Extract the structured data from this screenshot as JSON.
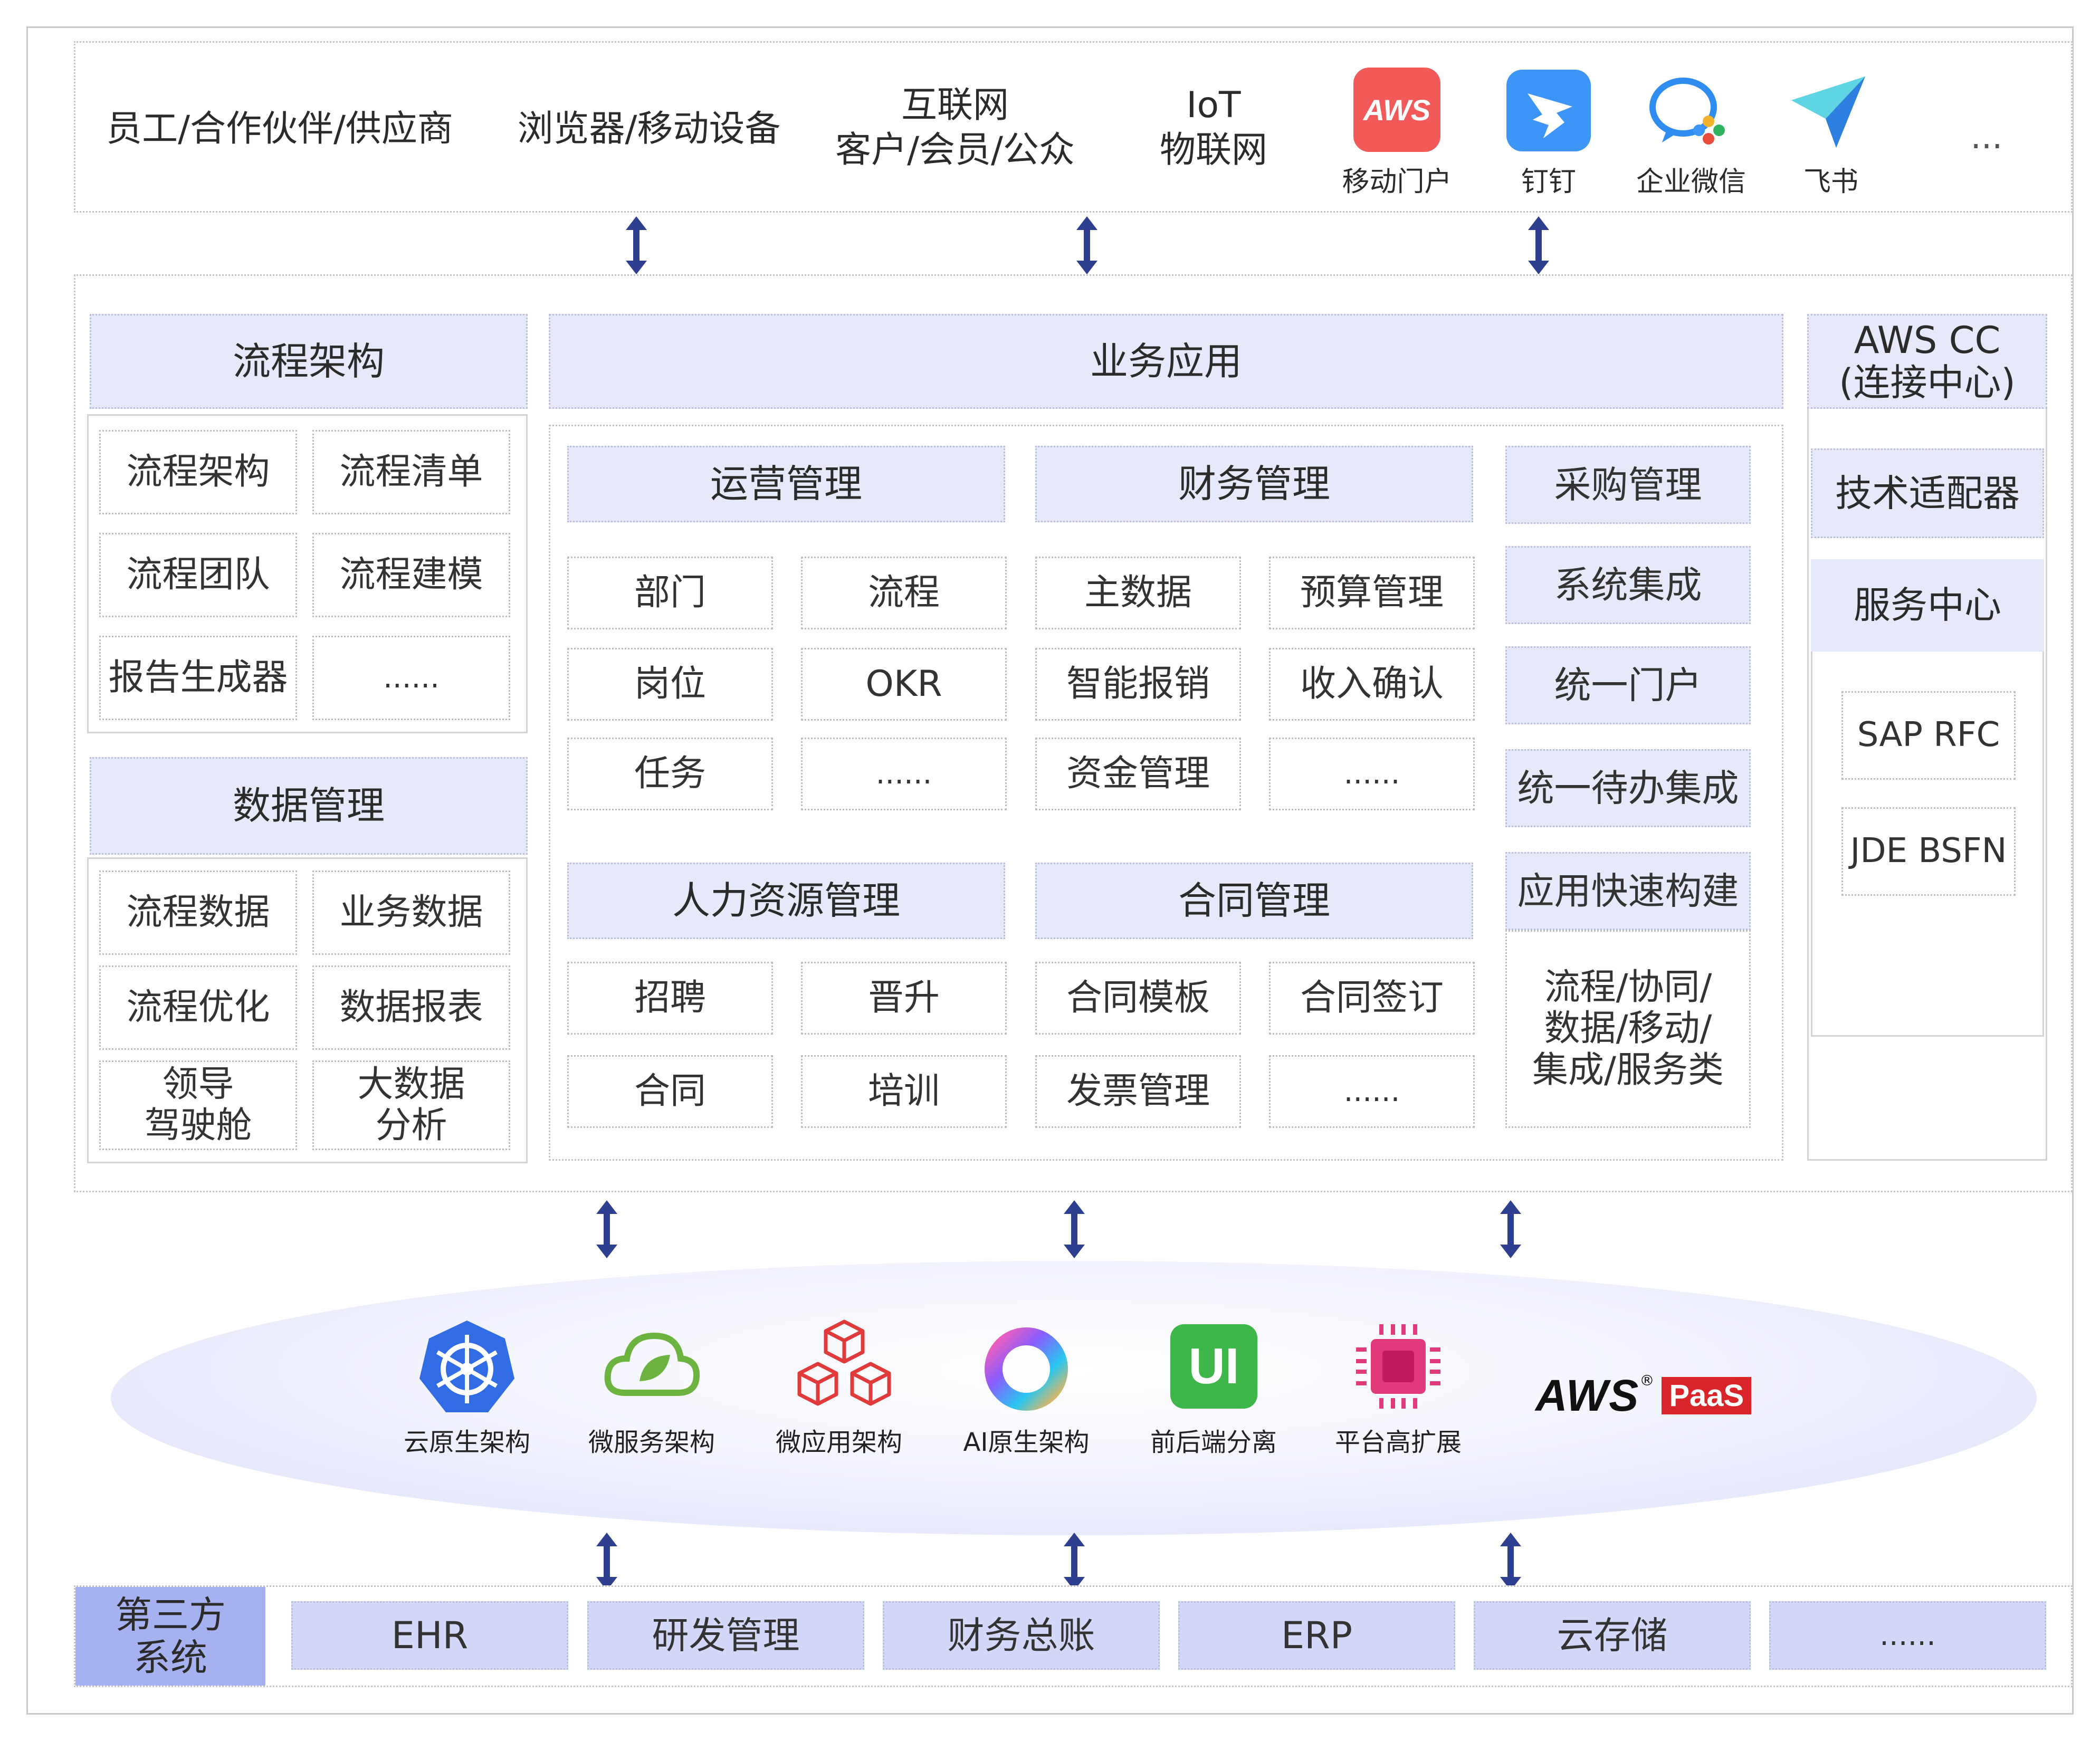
{
  "top_row": {
    "items": [
      "员工/合作伙伴/供应商",
      "浏览器/移动设备"
    ],
    "internet_line1": "互联网",
    "internet_line2": "客户/会员/公众",
    "iot_line1": "IoT",
    "iot_line2": "物联网",
    "apps": [
      {
        "label": "移动门户",
        "icon": "aws-mobile-portal-icon",
        "icon_text": "AWS",
        "color": "#f25a5a"
      },
      {
        "label": "钉钉",
        "icon": "dingtalk-icon",
        "color": "#3d96f7"
      },
      {
        "label": "企业微信",
        "icon": "wecom-icon",
        "color": "#2f8cf0"
      },
      {
        "label": "飞书",
        "icon": "feishu-icon",
        "color": "#3ec7d6"
      }
    ],
    "more": "..."
  },
  "process": {
    "header": "流程架构",
    "items": [
      "流程架构",
      "流程清单",
      "流程团队",
      "流程建模",
      "报告生成器",
      "......"
    ]
  },
  "data_mgmt": {
    "header": "数据管理",
    "items": [
      "流程数据",
      "业务数据",
      "流程优化",
      "数据报表"
    ],
    "leader_line1": "领导",
    "leader_line2": "驾驶舱",
    "bigdata_line1": "大数据",
    "bigdata_line2": "分析"
  },
  "business": {
    "header": "业务应用",
    "ops": {
      "header": "运营管理",
      "items": [
        "部门",
        "流程",
        "岗位",
        "OKR",
        "任务",
        "......"
      ]
    },
    "finance": {
      "header": "财务管理",
      "items": [
        "主数据",
        "预算管理",
        "智能报销",
        "收入确认",
        "资金管理",
        "......"
      ]
    },
    "hr": {
      "header": "人力资源管理",
      "items": [
        "招聘",
        "晋升",
        "合同",
        "培训"
      ]
    },
    "contract": {
      "header": "合同管理",
      "items": [
        "合同模板",
        "合同签订",
        "发票管理",
        "......"
      ]
    },
    "right": {
      "items": [
        "采购管理",
        "系统集成",
        "统一门户",
        "统一待办集成",
        "应用快速构建"
      ],
      "multi_line1": "流程/协同/",
      "multi_line2": "数据/移动/",
      "multi_line3": "集成/服务类"
    }
  },
  "aws_cc": {
    "title_line1": "AWS CC",
    "title_line2": "(连接中心)",
    "adapter": "技术适配器",
    "service_center": "服务中心",
    "items": [
      "SAP RFC",
      "JDE BSFN"
    ]
  },
  "tech": {
    "items": [
      {
        "label": "云原生架构",
        "icon": "kubernetes-icon"
      },
      {
        "label": "微服务架构",
        "icon": "spring-cloud-icon"
      },
      {
        "label": "微应用架构",
        "icon": "cubes-icon"
      },
      {
        "label": "AI原生架构",
        "icon": "ai-ring-icon"
      },
      {
        "label": "前后端分离",
        "icon": "ui-icon",
        "icon_text": "UI"
      },
      {
        "label": "平台高扩展",
        "icon": "chip-icon"
      }
    ],
    "brand": "AWS",
    "brand_reg": "®",
    "brand_badge": "PaaS"
  },
  "third_party": {
    "label_line1": "第三方",
    "label_line2": "系统",
    "items": [
      "EHR",
      "研发管理",
      "财务总账",
      "ERP",
      "云存储",
      "......"
    ]
  },
  "colors": {
    "header_fill": "#e6e9fa",
    "arrow": "#2e3f8f",
    "third_party_fill": "#a6b1ef",
    "third_item_fill": "#d3d8f8",
    "badge_red": "#d9252a"
  }
}
